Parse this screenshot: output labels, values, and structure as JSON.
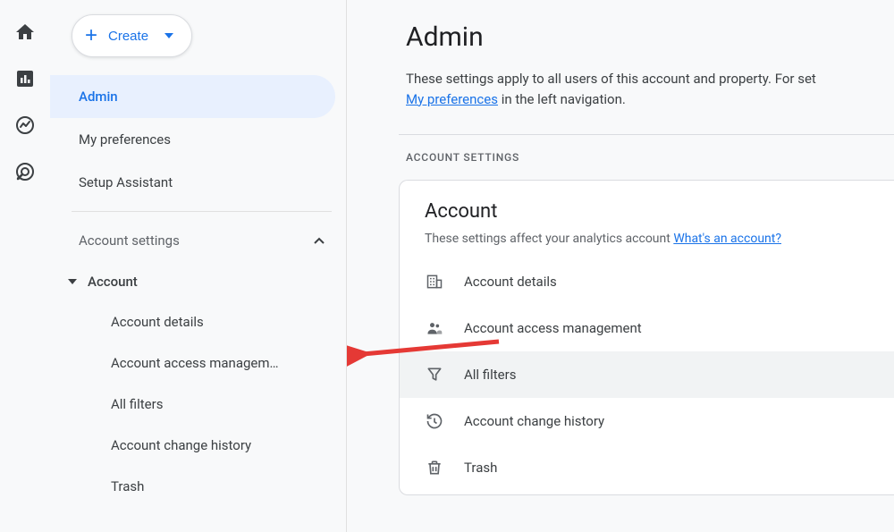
{
  "create_label": "Create",
  "nav": {
    "admin": "Admin",
    "preferences": "My preferences",
    "setup": "Setup Assistant"
  },
  "sidebar": {
    "section_label": "Account settings",
    "account_parent": "Account",
    "items": {
      "details": "Account details",
      "access": "Account access managem…",
      "filters": "All filters",
      "history": "Account change history",
      "trash": "Trash"
    }
  },
  "main": {
    "title": "Admin",
    "desc_before": "These settings apply to all users of this account and property. For set",
    "desc_link": "My preferences",
    "desc_after": " in the left navigation.",
    "section_label": "ACCOUNT SETTINGS",
    "card": {
      "title": "Account",
      "sub_before": "These settings affect your analytics account ",
      "sub_link": "What's an account?",
      "rows": {
        "details": "Account details",
        "access": "Account access management",
        "filters": "All filters",
        "history": "Account change history",
        "trash": "Trash"
      }
    }
  }
}
